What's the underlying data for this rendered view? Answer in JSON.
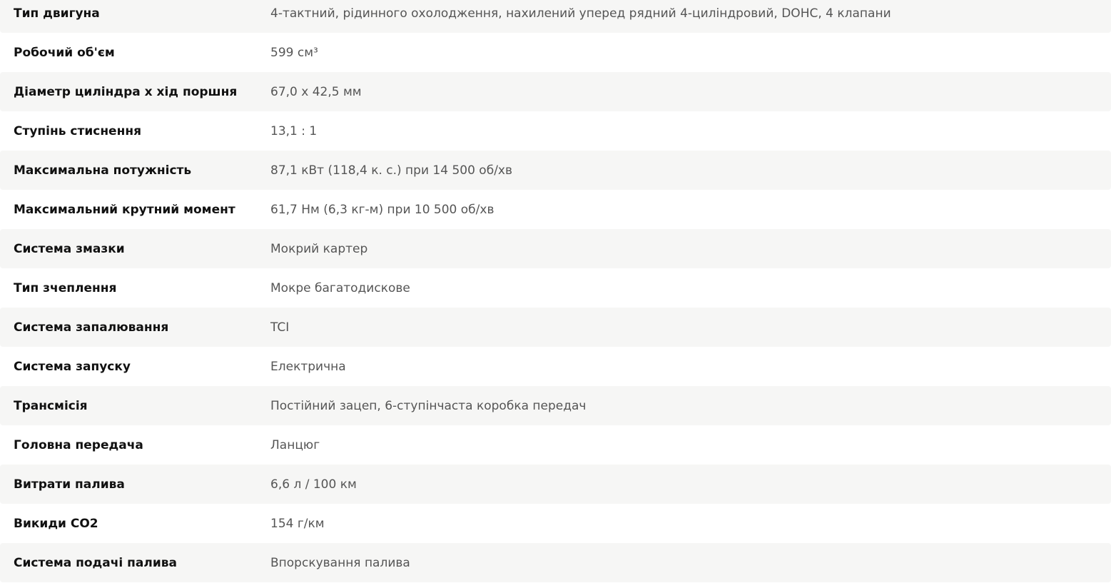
{
  "specs": [
    {
      "label": "Тип двигуна",
      "value": "4-тактний, рідинного охолодження, нахилений уперед рядний 4-циліндровий, DOHC, 4 клапани"
    },
    {
      "label": "Робочий об'єм",
      "value": "599 см³"
    },
    {
      "label": "Діаметр циліндра x хід поршня",
      "value": "67,0 x 42,5 мм"
    },
    {
      "label": "Ступінь стиснення",
      "value": "13,1 : 1"
    },
    {
      "label": "Максимальна потужність",
      "value": "87,1 кВт (118,4 к. с.) при 14 500 об/хв"
    },
    {
      "label": "Максимальний крутний момент",
      "value": "61,7 Нм (6,3 кг-м) при 10 500 об/хв"
    },
    {
      "label": "Система змазки",
      "value": "Мокрий картер"
    },
    {
      "label": "Тип зчеплення",
      "value": "Мокре багатодискове"
    },
    {
      "label": "Система запалювання",
      "value": "TCI"
    },
    {
      "label": "Система запуску",
      "value": "Електрична"
    },
    {
      "label": "Трансмісія",
      "value": "Постійний зацеп, 6-ступінчаста коробка передач"
    },
    {
      "label": "Головна передача",
      "value": "Ланцюг"
    },
    {
      "label": "Витрати палива",
      "value": "6,6 л / 100 км"
    },
    {
      "label": "Викиди CO2",
      "value": "154 г/км"
    },
    {
      "label": "Система подачі палива",
      "value": "Впорскування палива"
    }
  ]
}
